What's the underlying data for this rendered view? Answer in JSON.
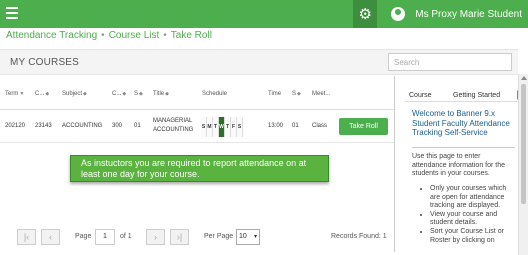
{
  "header": {
    "user_name": "Ms Proxy Marie Student"
  },
  "breadcrumb": {
    "items": [
      "Attendance Tracking",
      "Course List",
      "Take Roll"
    ]
  },
  "page": {
    "title": "MY COURSES",
    "search_placeholder": "Search"
  },
  "table": {
    "headers": {
      "term": "Term",
      "crn": "C...",
      "subject": "Subject",
      "course": "C...",
      "section": "S",
      "title": "Title",
      "schedule": "Schedule",
      "time": "Time",
      "s2": "S",
      "meet": "Meet..."
    },
    "row": {
      "term": "202120",
      "crn": "23143",
      "subject": "ACCOUNTING",
      "course": "300",
      "section": "01",
      "title_line1": "MANAGERIAL",
      "title_line2": "ACCOUNTING",
      "days": [
        "S",
        "M",
        "T",
        "W",
        "T",
        "F",
        "S"
      ],
      "active_day_index": 3,
      "time": "13:00",
      "s2": "01",
      "meet": "Class",
      "action_label": "Take Roll"
    }
  },
  "tooltip": {
    "text": "As instuctors you are required to report attendance on at least one day for your course."
  },
  "pager": {
    "page_label": "Page",
    "page_value": "1",
    "of_label": "of 1",
    "per_page_label": "Per Page",
    "per_page_value": "10",
    "records_label": "Records Found: 1"
  },
  "side_panel": {
    "tabs": [
      "Course",
      "Getting Started"
    ],
    "heading": "Welcome to Banner 9.x Student Faculty Attendance Tracking Self-Service",
    "intro": "Use this page to enter attendance information for the students in your courses.",
    "bullets": [
      "Only your courses which are open for attendance tracking are displayed.",
      "View your course and student details.",
      "Sort your Course List or Roster by clicking on"
    ]
  },
  "colors": {
    "brand_green": "#4cae4c",
    "link_blue": "#1a5e8f"
  }
}
